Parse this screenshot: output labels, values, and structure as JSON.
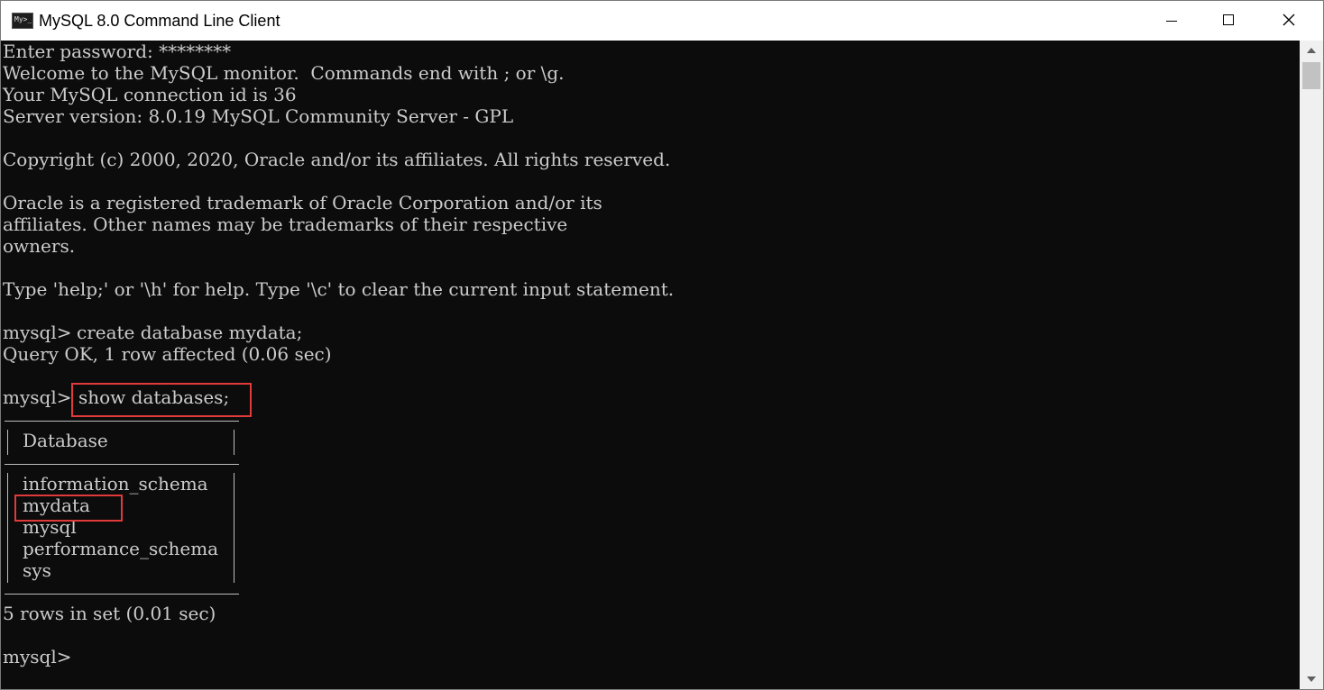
{
  "window": {
    "title": "MySQL 8.0 Command Line Client",
    "icon_label": "My>_",
    "controls": [
      "minimize-icon",
      "maximize-icon",
      "close-icon"
    ]
  },
  "console": {
    "lines": [
      "Enter password: ********",
      "Welcome to the MySQL monitor.  Commands end with ; or \\g.",
      "Your MySQL connection id is 36",
      "Server version: 8.0.19 MySQL Community Server - GPL",
      "",
      "Copyright (c) 2000, 2020, Oracle and/or its affiliates. All rights reserved.",
      "",
      "Oracle is a registered trademark of Oracle Corporation and/or its",
      "affiliates. Other names may be trademarks of their respective",
      "owners.",
      "",
      "Type 'help;' or '\\h' for help. Type '\\c' to clear the current input statement.",
      "",
      "mysql> create database mydata;",
      "Query OK, 1 row affected (0.06 sec)",
      "",
      "mysql> show databases;",
      "+--------------------+",
      "| Database           |",
      "+--------------------+",
      "| information_schema |",
      "| mydata             |",
      "| mysql              |",
      "| performance_schema |",
      "| sys                |",
      "+--------------------+",
      "5 rows in set (0.01 sec)",
      "",
      "mysql>"
    ],
    "prompt": "mysql>",
    "command_create": "create database mydata;",
    "command_show": "show databases;",
    "table_header": "Database",
    "table_rows": [
      "information_schema",
      "mydata",
      "mysql",
      "performance_schema",
      "sys"
    ],
    "table_border": "+--------------------+"
  },
  "colors": {
    "background": "#0c0c0c",
    "text": "#cccccc",
    "highlight": "#e03a3a"
  }
}
